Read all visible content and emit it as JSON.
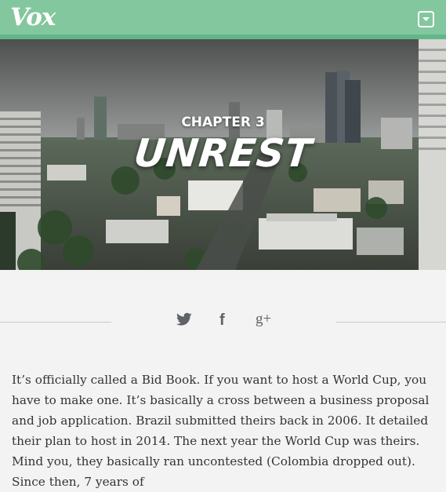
{
  "header": {
    "logo_text": "Vox",
    "bar_color": "#83c79e",
    "menu_icon": "chevron-down-icon"
  },
  "hero": {
    "chapter_label": "CHAPTER 3",
    "title": "UNREST"
  },
  "share": {
    "icons": [
      "twitter-icon",
      "facebook-icon",
      "google-plus-icon"
    ],
    "facebook_glyph": "f",
    "google_plus_glyph": "g+"
  },
  "article": {
    "paragraph": "It’s officially called a Bid Book. If you want to host a World Cup, you have to make one. It’s basically a cross between a business proposal and job application. Brazil submitted theirs back in 2006. It detailed their plan to host in 2014. The next year the World Cup was theirs. Mind you, they basically ran uncontested (Colombia dropped out). Since then, 7 years of"
  }
}
